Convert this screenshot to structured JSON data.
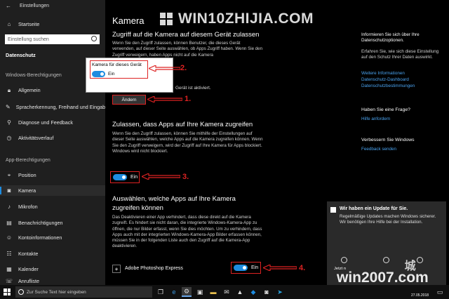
{
  "window": {
    "title": "Einstellungen"
  },
  "sidebar": {
    "home": "Startseite",
    "search_placeholder": "Einstellung suchen",
    "section_title": "Datenschutz",
    "windows_permissions_header": "Windows-Berechtigungen",
    "windows_items": [
      {
        "label": "Allgemein",
        "icon": "lock-icon"
      },
      {
        "label": "Spracherkennung, Freihand und Eingabe",
        "icon": "pen-icon"
      },
      {
        "label": "Diagnose und Feedback",
        "icon": "diagnostics-icon"
      },
      {
        "label": "Aktivitätsverlauf",
        "icon": "history-icon"
      }
    ],
    "app_permissions_header": "App-Berechtigungen",
    "app_items": [
      {
        "label": "Position",
        "icon": "location-icon"
      },
      {
        "label": "Kamera",
        "icon": "camera-icon",
        "selected": true
      },
      {
        "label": "Mikrofon",
        "icon": "microphone-icon"
      },
      {
        "label": "Benachrichtigungen",
        "icon": "notification-icon"
      },
      {
        "label": "Kontoinformationen",
        "icon": "account-icon"
      },
      {
        "label": "Kontakte",
        "icon": "contacts-icon"
      },
      {
        "label": "Kalender",
        "icon": "calendar-icon"
      },
      {
        "label": "Anrufliste",
        "icon": "call-history-icon"
      }
    ]
  },
  "main": {
    "title": "Kamera",
    "section1": {
      "heading": "Zugriff auf die Kamera auf diesem Gerät zulassen",
      "text": "Wenn Sie den Zugriff zulassen, können Benutzer, die dieses Gerät verwenden, auf dieser Seite auswählen, ob Apps Zugriff haben. Wenn Sie den Zugriff verweigern, haben Apps nicht auf die Kamera",
      "status": "Gerät ist aktiviert.",
      "button": "Ändern"
    },
    "popup": {
      "title": "Kamera für dieses Gerät",
      "toggle_label": "Ein"
    },
    "section2": {
      "heading": "Zulassen, dass Apps auf Ihre Kamera zugreifen",
      "text": "Wenn Sie den Zugriff zulassen, können Sie mithilfe der Einstellungen auf dieser Seite auswählen, welche Apps auf die Kamera zugreifen können. Wenn Sie den Zugriff verweigern, wird der Zugriff auf Ihre Kamera für Apps blockiert. Windows wird nicht blockiert.",
      "toggle_label": "Ein"
    },
    "section3": {
      "heading_line1": "Auswählen, welche Apps auf Ihre Kamera",
      "heading_line2": "zugreifen können",
      "text": "Das Deaktivieren einer App verhindert, dass diese direkt auf die Kamera zugreift. Es hindert sie nicht daran, die integrierte Windows-Kamera-App zu öffnen, die nur Bilder erfasst, wenn Sie dies möchten. Um zu verhindern, dass Apps auch mit der integrierten Windows-Kamera-App Bilder erfassen können, müssen Sie in der folgenden Liste auch den Zugriff auf die Kamera-App deaktivieren.",
      "app_name": "Adobe Photoshop Express",
      "app_toggle_label": "Ein"
    },
    "annotations": [
      "1.",
      "2.",
      "3.",
      "4."
    ]
  },
  "right": {
    "info_heading": "Informieren Sie sich über Ihre Datenschutzoptionen.",
    "info_text": "Erfahren Sie, wie sich diese Einstellung auf den Schutz Ihrer Daten auswirkt.",
    "links": [
      "Weitere Informationen",
      "Datenschutz-Dashboard",
      "Datenschutzbestimmungen"
    ],
    "question_heading": "Haben Sie eine Frage?",
    "question_link": "Hilfe anfordern",
    "improve_heading": "Verbessern Sie Windows",
    "improve_link": "Feedback senden"
  },
  "notification": {
    "title": "Wir haben ein Update für Sie.",
    "text": "Regelmäßige Updates machen Windows sicherer. Wir benötigen Ihre Hilfe bei der Installation.",
    "action": "Jetzt n"
  },
  "watermarks": {
    "top": "WIN10ZHIJIA.COM",
    "bottom": "win2007.com",
    "bottom_glyph": "城"
  },
  "taskbar": {
    "search_placeholder": "Zur Suche Text hier eingeben",
    "date": "27.05.2018"
  },
  "colors": {
    "accent": "#1e8ce0",
    "annotation_red": "#dd2222",
    "link": "#4aa3f0"
  }
}
